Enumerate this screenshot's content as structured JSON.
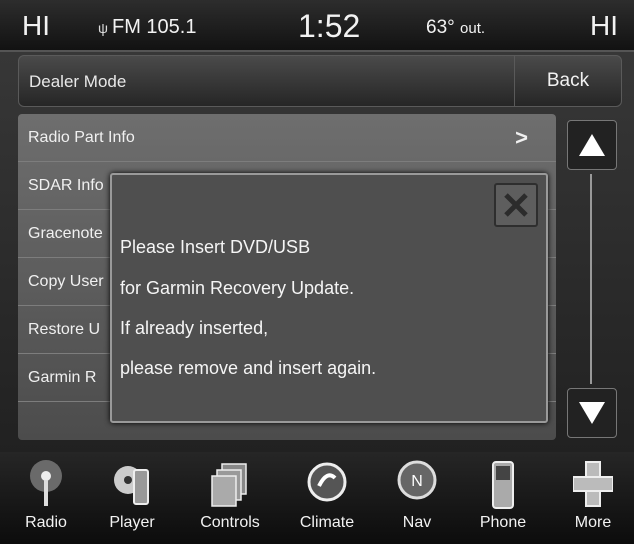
{
  "status": {
    "hi_left": "HI",
    "radio_band": "FM 105.1",
    "clock": "1:52",
    "temp": "63°",
    "temp_suffix": "out.",
    "hi_right": "HI"
  },
  "header": {
    "title": "Dealer Mode",
    "back_label": "Back"
  },
  "list": {
    "items": [
      {
        "label": "Radio Part Info",
        "chevron": ">"
      },
      {
        "label": "SDAR Info"
      },
      {
        "label": "Gracenote"
      },
      {
        "label": "Copy User"
      },
      {
        "label": "Restore U"
      },
      {
        "label": "Garmin R"
      }
    ]
  },
  "popup": {
    "lines": [
      "Please Insert DVD/USB",
      "for Garmin Recovery Update.",
      "If already inserted,",
      "please remove and insert again."
    ]
  },
  "nav": {
    "items": [
      {
        "label": "Radio",
        "icon": "radio-icon"
      },
      {
        "label": "Player",
        "icon": "player-icon"
      },
      {
        "label": "Controls",
        "icon": "controls-icon"
      },
      {
        "label": "Climate",
        "icon": "climate-icon"
      },
      {
        "label": "Nav",
        "icon": "compass-icon"
      },
      {
        "label": "Phone",
        "icon": "phone-icon"
      },
      {
        "label": "More",
        "icon": "plus-icon"
      }
    ]
  }
}
